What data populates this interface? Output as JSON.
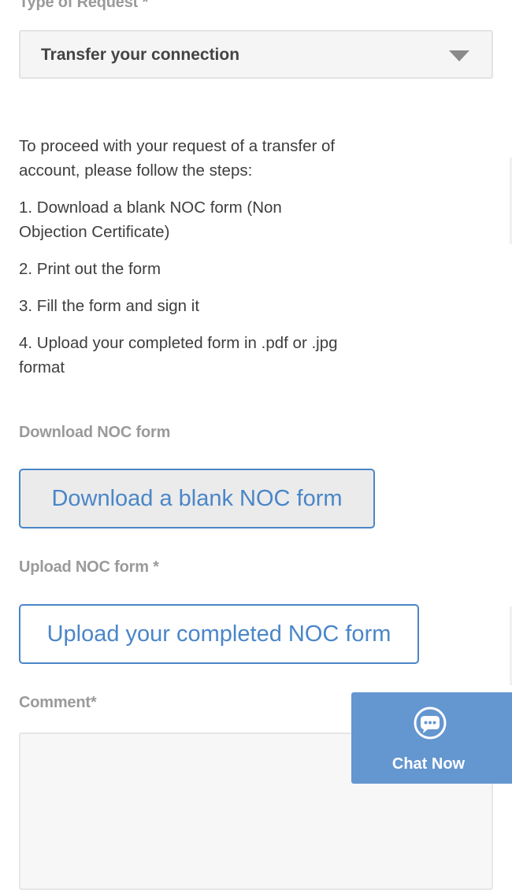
{
  "request": {
    "label": "Type of Request",
    "required_mark": "*",
    "selected_value": "Transfer your connection"
  },
  "instructions": {
    "intro": "To proceed with your request of a transfer of account, please follow the steps:",
    "steps": [
      "1. Download a blank NOC form (Non Objection Certificate)",
      "2. Print out the form",
      "3. Fill the form and sign it",
      "4. Upload your completed form in .pdf or .jpg format"
    ]
  },
  "download": {
    "label": "Download NOC form",
    "button_label": "Download a blank NOC form"
  },
  "upload": {
    "label": "Upload NOC form",
    "required_mark": "*",
    "button_label": "Upload your completed NOC form"
  },
  "comment": {
    "label": "Comment*"
  },
  "chat": {
    "label": "Chat Now"
  },
  "colors": {
    "accent": "#4a86c8",
    "chat_bg": "#6496d0"
  }
}
